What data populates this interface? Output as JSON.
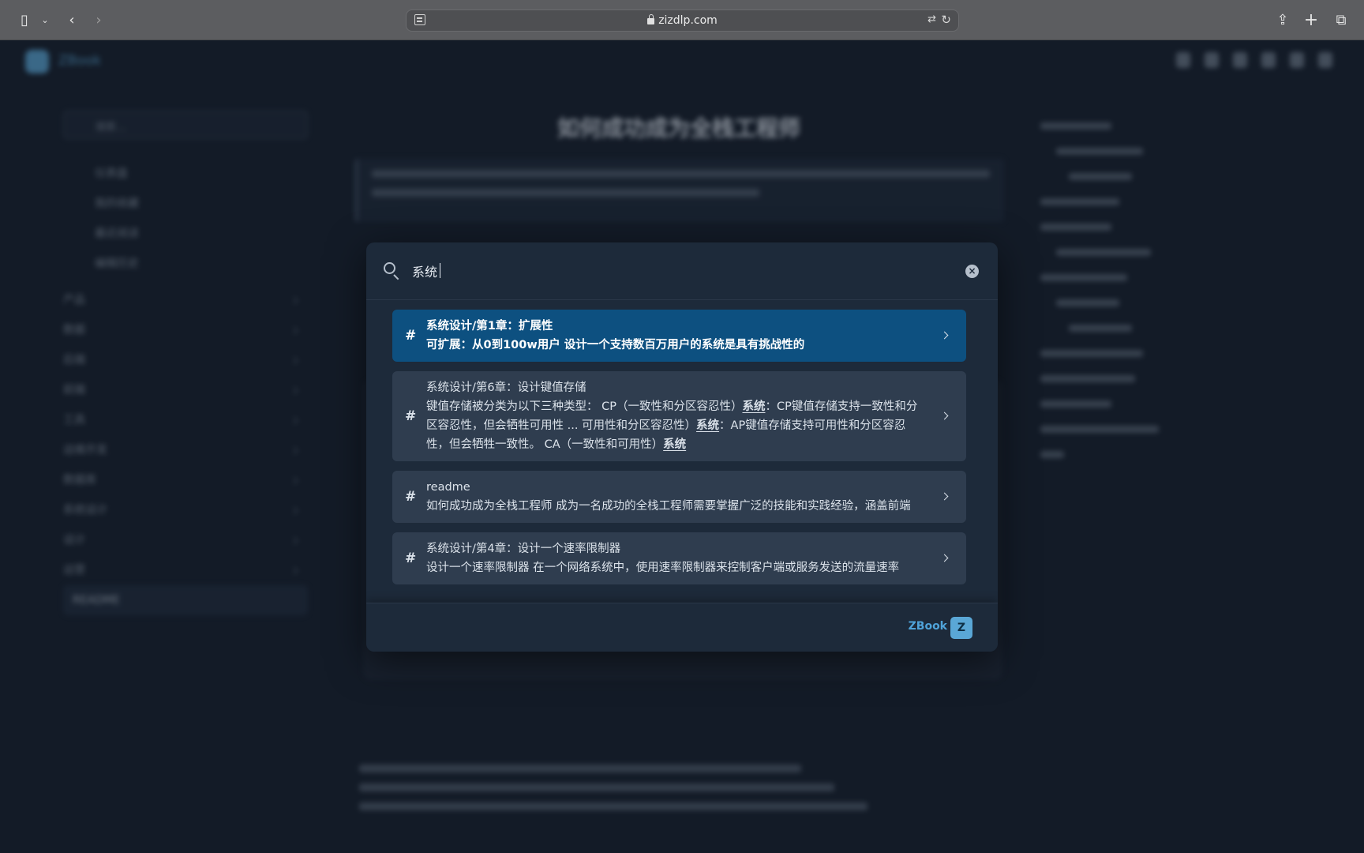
{
  "browser": {
    "url": "zizdlp.com"
  },
  "background": {
    "site_name": "ZBook",
    "page_title": "如何成功成为全栈工程师",
    "sidebar_search_placeholder": "搜索...",
    "sidebar_items": [
      "仪表盘",
      "我的收藏",
      "最近阅读",
      "编辑历史"
    ],
    "sidebar_categories": [
      "产品",
      "数据",
      "后端",
      "前端",
      "工具",
      "运维开发",
      "数据库",
      "系统设计",
      "设计",
      "运营"
    ],
    "sidebar_active": "README"
  },
  "search": {
    "query": "系统",
    "clear_label": "×",
    "results": [
      {
        "title": "系统设计/第1章：扩展性",
        "text_parts": [
          {
            "t": "可扩展：从0到100w用户 设计一个支持数百万用户的系统是具有挑战性的",
            "hl": false
          }
        ]
      },
      {
        "title": "系统设计/第6章：设计键值存储",
        "text_parts": [
          {
            "t": "键值存储被分类为以下三种类型： CP（一致性和分区容忍性）",
            "hl": false
          },
          {
            "t": "系统",
            "hl": true
          },
          {
            "t": "：CP键值存储支持一致性和分区容忍性，但会牺牲可用性 ... 可用性和分区容忍性）",
            "hl": false
          },
          {
            "t": "系统",
            "hl": true
          },
          {
            "t": "：AP键值存储支持可用性和分区容忍性，但会牺牲一致性。 CA（一致性和可用性）",
            "hl": false
          },
          {
            "t": "系统",
            "hl": true
          }
        ]
      },
      {
        "title": "readme",
        "text_parts": [
          {
            "t": "如何成功成为全栈工程师 成为一名成功的全栈工程师需要掌握广泛的技能和实践经验，涵盖前端",
            "hl": false
          }
        ]
      },
      {
        "title": "系统设计/第4章：设计一个速率限制器",
        "text_parts": [
          {
            "t": "设计一个速率限制器 在一个网络系统中，使用速率限制器来控制客户端或服务发送的流量速率",
            "hl": false
          }
        ]
      }
    ],
    "footer_brand": "ZBook"
  },
  "colors": {
    "accent": "#4fa3d9",
    "selected_result": "#0d5080",
    "result_bg": "#2f3d4f",
    "modal_bg": "#1d2a3a"
  }
}
